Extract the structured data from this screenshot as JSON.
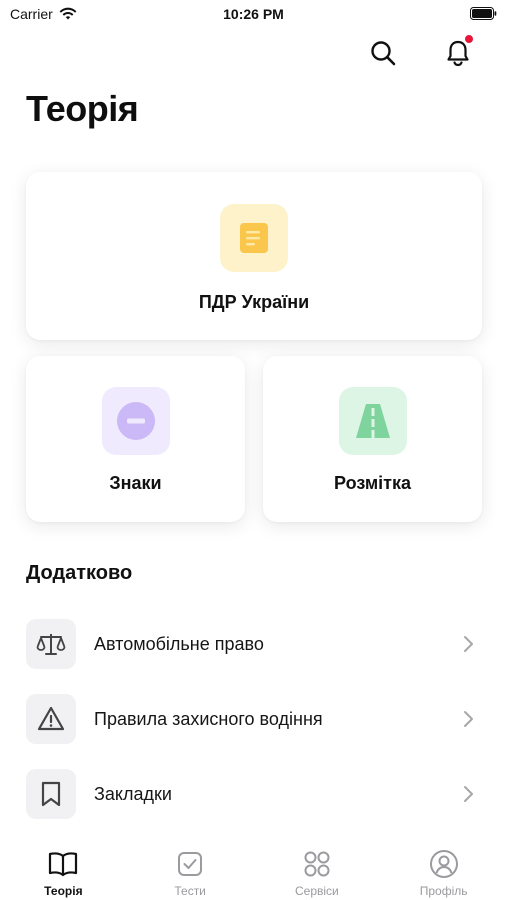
{
  "status_bar": {
    "carrier": "Carrier",
    "time": "10:26 PM"
  },
  "header": {
    "title": "Теорія",
    "search_icon": "search-icon",
    "notifications_icon": "bell-icon",
    "has_unread": true
  },
  "cards": {
    "pdr": {
      "label": "ПДР України",
      "icon": "document-icon",
      "icon_bg": "#fdf2c9",
      "icon_color": "#fbc64c"
    },
    "znaky": {
      "label": "Знаки",
      "icon": "minus-circle-icon",
      "icon_bg": "#efeafd",
      "icon_color": "#cbb8f6"
    },
    "rozmitka": {
      "label": "Розмітка",
      "icon": "road-icon",
      "icon_bg": "#ddf5e5",
      "icon_color": "#7fd39c"
    }
  },
  "extra": {
    "title": "Додатково",
    "items": [
      {
        "label": "Автомобільне право",
        "icon": "scales-icon"
      },
      {
        "label": "Правила захисного водіння",
        "icon": "warning-icon"
      },
      {
        "label": "Закладки",
        "icon": "bookmark-icon"
      }
    ]
  },
  "tabs": [
    {
      "label": "Теорія",
      "icon": "book-icon",
      "active": true
    },
    {
      "label": "Тести",
      "icon": "checkbox-icon",
      "active": false
    },
    {
      "label": "Сервіси",
      "icon": "grid-icon",
      "active": false
    },
    {
      "label": "Профіль",
      "icon": "profile-icon",
      "active": false
    }
  ],
  "colors": {
    "notification_dot": "#e8173a",
    "tab_inactive": "#9a9a9f",
    "tab_active": "#111111"
  }
}
